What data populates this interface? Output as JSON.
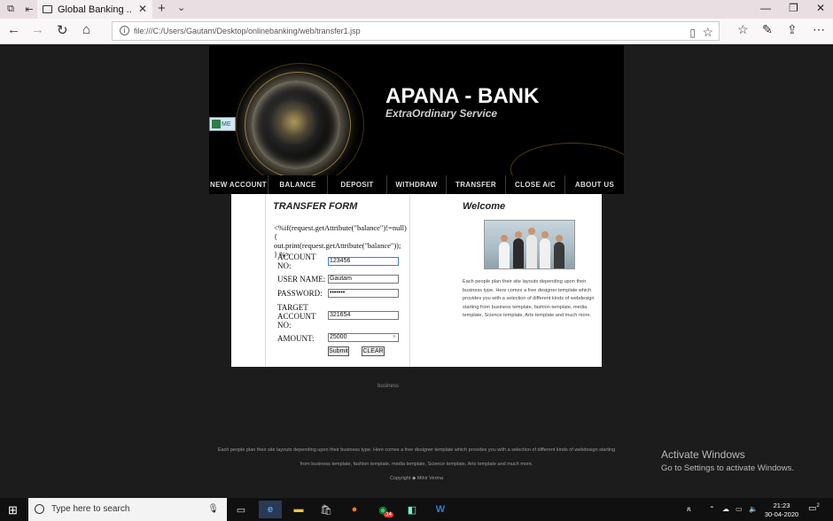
{
  "browser": {
    "tab_title": "Global Banking ..",
    "address": "file:///C:/Users/Gautam/Desktop/onlinebanking/web/transfer1.jsp"
  },
  "header": {
    "logo": "APANA - BANK",
    "tagline": "ExtraOrdinary Service",
    "home_label": "ME"
  },
  "menu": [
    "NEW ACCOUNT",
    "BALANCE",
    "DEPOSIT",
    "WITHDRAW",
    "TRANSFER",
    "CLOSE A/C",
    "ABOUT US"
  ],
  "form": {
    "title": "TRANSFER FORM",
    "jsp_text": "<%if(request.getAttribute(\"balance\")!=null) { out.print(request.getAttribute(\"balance\")); } %>",
    "fields": [
      {
        "label": "ACCOUNT NO:",
        "value": "123456"
      },
      {
        "label": "USER NAME:",
        "value": "Gautam"
      },
      {
        "label": "PASSWORD:",
        "value": "•••••••"
      },
      {
        "label": "TARGET ACCOUNT NO:",
        "value": "321654"
      },
      {
        "label": "AMOUNT:",
        "value": "25000"
      }
    ],
    "submit_label": "Submit",
    "clear_label": "CLEAR"
  },
  "welcome": {
    "title": "Welcome",
    "text": "Each people plan their site layouts depending upon their business type. Here comes a free designer template which provides you with a selection of different kinds of webdesign starting from business template, fashion template, media template, Science template, Arts template and much more."
  },
  "page_footer": {
    "business": "business",
    "line1": "Each people plan their site layouts depending upon their business type. Here comes a free designer template which provides you with a selection of different kinds of webdesign starting",
    "line2": "from business template, fashion template, media template, Science template, Arts template and much more.",
    "copyright": "Copyright ◆ Mihir Verma"
  },
  "activate": {
    "title": "Activate Windows",
    "subtitle": "Go to Settings to activate Windows."
  },
  "taskbar": {
    "search_placeholder": "Type here to search",
    "time": "21:23",
    "date": "30-04-2020",
    "whatsapp_badge": "14",
    "notification_count": "2"
  }
}
